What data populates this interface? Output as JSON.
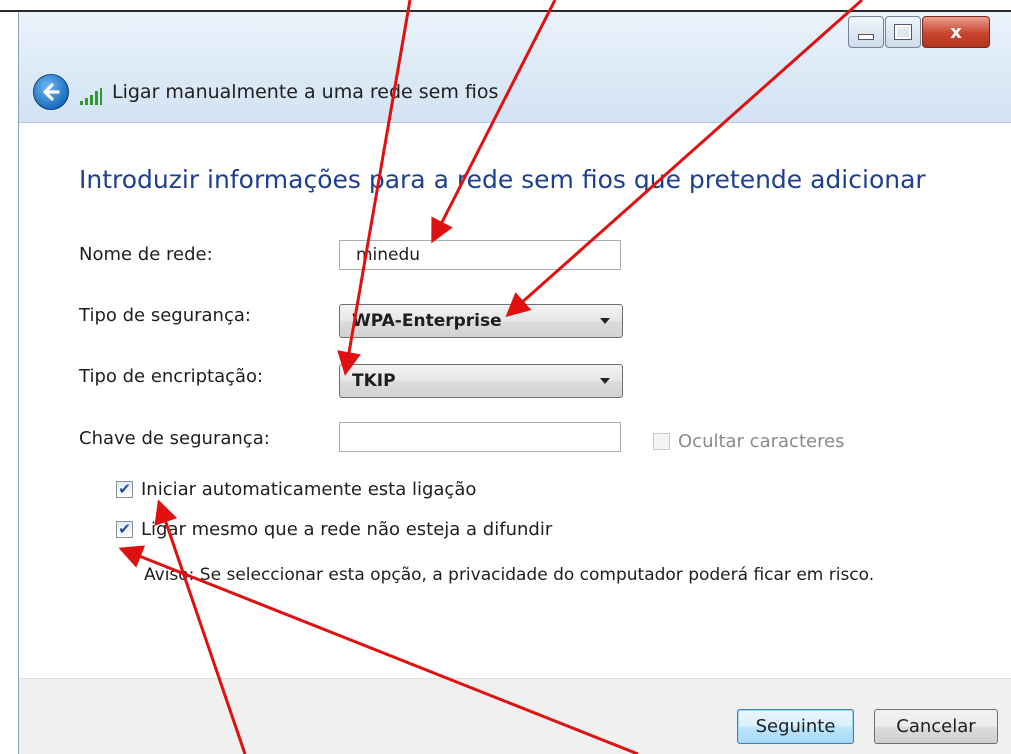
{
  "window": {
    "title": "Ligar manualmente a uma rede sem fios",
    "controls": {
      "minimize_icon": "minimize-icon",
      "maximize_icon": "maximize-icon",
      "close_glyph": "x"
    }
  },
  "page": {
    "heading": "Introduzir informações para a rede sem fios que pretende adicionar"
  },
  "form": {
    "network_name": {
      "label": "Nome de rede:",
      "value": "minedu"
    },
    "security_type": {
      "label": "Tipo de segurança:",
      "value": "WPA-Enterprise"
    },
    "encryption_type": {
      "label": "Tipo de encriptação:",
      "value": "TKIP"
    },
    "security_key": {
      "label": "Chave de segurança:",
      "value": ""
    },
    "hide_characters": {
      "label": "Ocultar caracteres",
      "checked": false,
      "enabled": false
    }
  },
  "options": {
    "auto_start": {
      "label": "Iniciar automaticamente esta ligação",
      "checked": true
    },
    "connect_hidden": {
      "label": "Ligar mesmo que a rede não esteja a difundir",
      "checked": true
    },
    "warning": "Aviso: Se seleccionar esta opção, a privacidade do computador poderá ficar em risco."
  },
  "buttons": {
    "next": "Seguinte",
    "cancel": "Cancelar"
  },
  "colors": {
    "heading": "#1e3f8f",
    "annotation_arrow": "#e01010",
    "check_mark": "#1c4f9c"
  },
  "icons": {
    "back": "back-arrow-icon",
    "signal": "wireless-signal-icon",
    "dropdown": "chevron-down-icon",
    "check": "checkmark-icon"
  }
}
